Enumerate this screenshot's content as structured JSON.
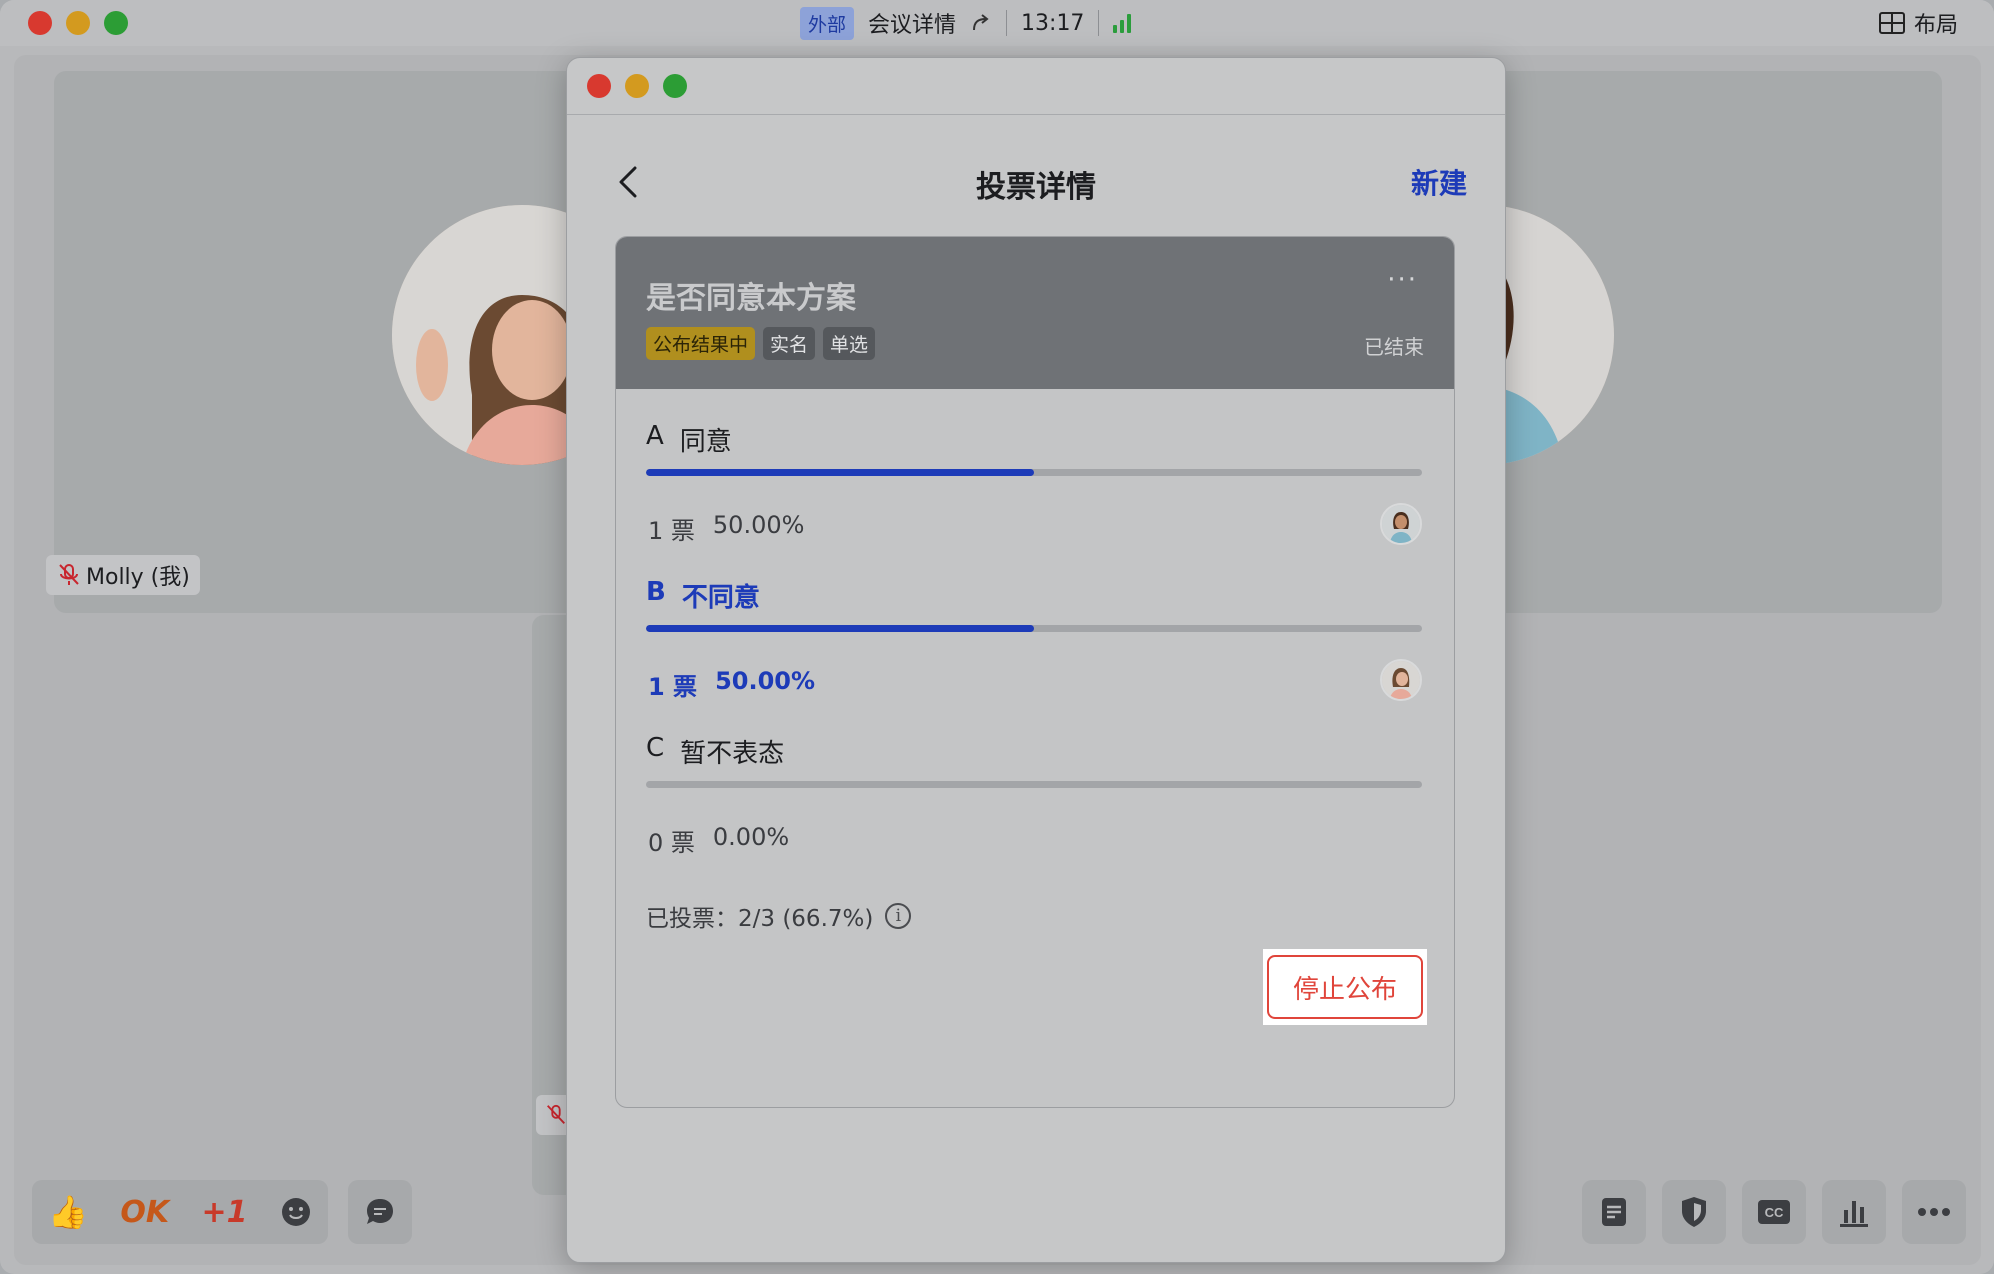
{
  "window": {
    "title": "会议详情",
    "external_badge": "外部",
    "time": "13:17",
    "layout_label": "布局"
  },
  "participants": {
    "self_name": "Molly (我)"
  },
  "reactions": [
    "OK",
    "+1"
  ],
  "modal": {
    "title": "投票详情",
    "new_label": "新建"
  },
  "poll": {
    "title": "是否同意本方案",
    "tags": [
      "公布结果中",
      "实名",
      "单选"
    ],
    "status": "已结束",
    "options": [
      {
        "letter": "A",
        "text": "同意",
        "votes": "1 票",
        "percent": "50.00%",
        "fraction": 0.5,
        "selected": false
      },
      {
        "letter": "B",
        "text": "不同意",
        "votes": "1 票",
        "percent": "50.00%",
        "fraction": 0.5,
        "selected": true
      },
      {
        "letter": "C",
        "text": "暂不表态",
        "votes": "0 票",
        "percent": "0.00%",
        "fraction": 0,
        "selected": false
      }
    ],
    "summary": "已投票：2/3 (66.7%)",
    "stop_button": "停止公布"
  },
  "colors": {
    "accent": "#1d3bb8",
    "danger": "#e0453b",
    "tag_yellow": "#b08f1e"
  }
}
